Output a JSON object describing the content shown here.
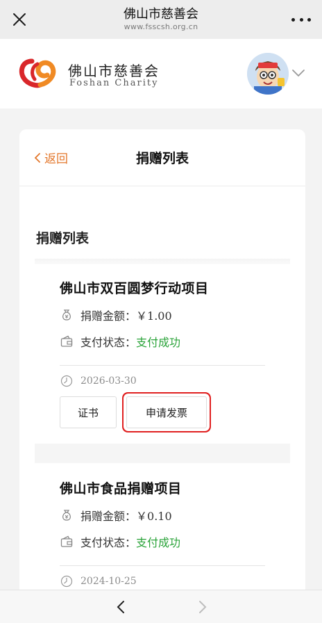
{
  "titlebar": {
    "title": "佛山市慈善会",
    "url": "www.fsscsh.org.cn",
    "close_icon": "close-icon",
    "more_icon": "more-dots-icon"
  },
  "site": {
    "logo_cn": "佛山市慈善会",
    "logo_en": "Foshan Charity",
    "brand_colors": [
      "#d9272a",
      "#f08a24"
    ]
  },
  "page": {
    "back_label": "返回",
    "title": "捐赠列表",
    "section_title": "捐赠列表",
    "accent_color": "#e3762a"
  },
  "donations": [
    {
      "project": "佛山市双百圆梦行动项目",
      "amount_label": "捐赠金额：",
      "amount": "￥1.00",
      "status_label": "支付状态：",
      "status": "支付成功",
      "date": "2026-03-30",
      "cert_button": "证书",
      "invoice_button": "申请发票"
    },
    {
      "project": "佛山市食品捐赠项目",
      "amount_label": "捐赠金额：",
      "amount": "￥0.10",
      "status_label": "支付状态：",
      "status": "支付成功",
      "date": "2024-10-25"
    }
  ],
  "status_color": "#2aa339",
  "highlight_color": "#e02020"
}
